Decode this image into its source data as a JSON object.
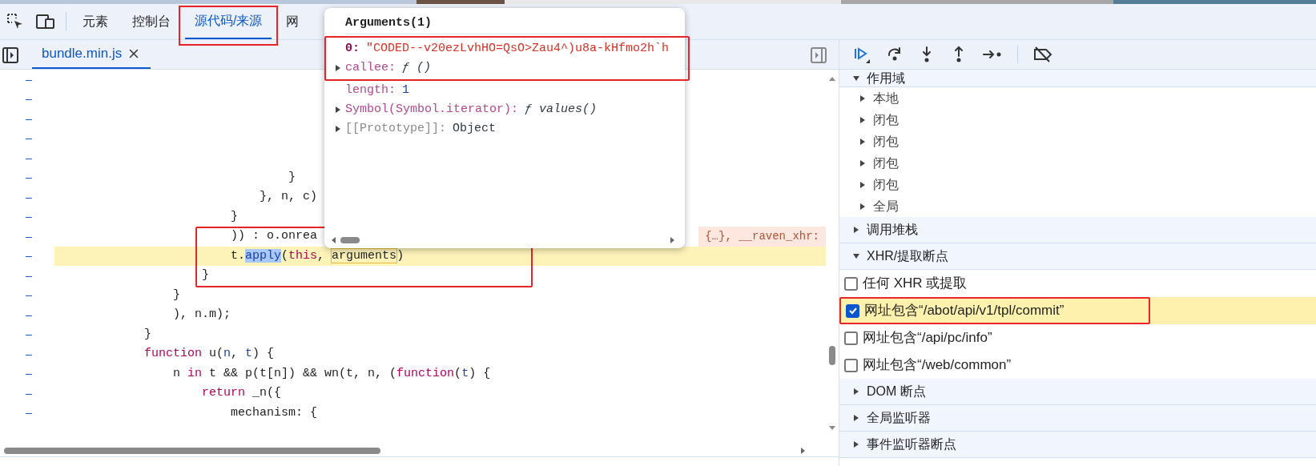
{
  "devtools_tabs": [
    {
      "label": "元素",
      "selected": false,
      "annotated": false
    },
    {
      "label": "控制台",
      "selected": false,
      "annotated": false
    },
    {
      "label": "源代码/来源",
      "selected": true,
      "annotated": true
    },
    {
      "label": "网",
      "selected": false,
      "annotated": false
    }
  ],
  "editor": {
    "file_tab": {
      "label": "bundle.min.js",
      "selected": true
    },
    "lines": [
      {
        "gutter": "–",
        "current": false
      },
      {
        "gutter": "–",
        "current": false
      },
      {
        "gutter": "–",
        "current": false
      },
      {
        "gutter": "–",
        "current": false
      },
      {
        "gutter": "–",
        "current": false
      },
      {
        "gutter": "–",
        "current": false,
        "tokens": [
          {
            "text": "                                }",
            "kind": "plain"
          }
        ]
      },
      {
        "gutter": "–",
        "current": false,
        "tokens": [
          {
            "text": "                            }, n, c)",
            "kind": "plain"
          }
        ]
      },
      {
        "gutter": "–",
        "current": false,
        "tokens": [
          {
            "text": "                        }",
            "kind": "plain"
          }
        ]
      },
      {
        "gutter": "–",
        "current": false,
        "tokens": [
          {
            "text": "                        )) : o.onrea",
            "kind": "plain"
          }
        ],
        "inline_value": "{…}, __raven_xhr:"
      },
      {
        "gutter": "–",
        "current": true,
        "tokens": [
          {
            "text": "                        t.",
            "kind": "plain"
          },
          {
            "text": "apply",
            "kind": "selected"
          },
          {
            "text": "(",
            "kind": "plain"
          },
          {
            "text": "this",
            "kind": "keyword"
          },
          {
            "text": ", ",
            "kind": "plain"
          },
          {
            "text": "arguments",
            "kind": "boxed"
          },
          {
            "text": ")",
            "kind": "plain"
          }
        ]
      },
      {
        "gutter": "–",
        "current": false,
        "tokens": [
          {
            "text": "                    }",
            "kind": "plain"
          }
        ]
      },
      {
        "gutter": "–",
        "current": false,
        "tokens": [
          {
            "text": "                }",
            "kind": "plain"
          }
        ]
      },
      {
        "gutter": "–",
        "current": false,
        "tokens": [
          {
            "text": "                ), n.m);",
            "kind": "plain"
          }
        ]
      },
      {
        "gutter": "–",
        "current": false,
        "tokens": [
          {
            "text": "            }",
            "kind": "plain"
          }
        ]
      },
      {
        "gutter": "–",
        "current": false,
        "tokens": [
          {
            "text": "            function",
            "kind": "keyword"
          },
          {
            "text": " u(",
            "kind": "plain"
          },
          {
            "text": "n",
            "kind": "param"
          },
          {
            "text": ", ",
            "kind": "plain"
          },
          {
            "text": "t",
            "kind": "param"
          },
          {
            "text": ") {",
            "kind": "plain"
          }
        ]
      },
      {
        "gutter": "–",
        "current": false,
        "tokens": [
          {
            "text": "                n ",
            "kind": "plain"
          },
          {
            "text": "in",
            "kind": "keyword"
          },
          {
            "text": " t && p(t[n]) && wn(t, n, (",
            "kind": "plain"
          },
          {
            "text": "function",
            "kind": "keyword"
          },
          {
            "text": "(",
            "kind": "plain"
          },
          {
            "text": "t",
            "kind": "param"
          },
          {
            "text": ") {",
            "kind": "plain"
          }
        ]
      },
      {
        "gutter": "–",
        "current": false,
        "tokens": [
          {
            "text": "                    return",
            "kind": "keyword"
          },
          {
            "text": " _n({",
            "kind": "plain"
          }
        ]
      },
      {
        "gutter": "–",
        "current": false,
        "tokens": [
          {
            "text": "                        mechanism: {",
            "kind": "plain"
          }
        ]
      }
    ]
  },
  "tooltip": {
    "title": "Arguments(1)",
    "properties": [
      {
        "expandable": false,
        "annotated": true,
        "tokens": [
          {
            "text": "0:",
            "kind": "index"
          },
          {
            "text": "\"CODED--v20ezLvhHO=QsO>Zau4^)u8a-kHfmo2h`h",
            "kind": "string"
          }
        ]
      },
      {
        "expandable": true,
        "annotated": true,
        "tokens": [
          {
            "text": "callee:",
            "kind": "property"
          },
          {
            "text": "ƒ ()",
            "kind": "function"
          }
        ]
      },
      {
        "expandable": false,
        "annotated": false,
        "tokens": [
          {
            "text": "length:",
            "kind": "property"
          },
          {
            "text": "1",
            "kind": "number"
          }
        ]
      },
      {
        "expandable": true,
        "annotated": false,
        "tokens": [
          {
            "text": "Symbol(Symbol.iterator):",
            "kind": "property"
          },
          {
            "text": "ƒ values()",
            "kind": "function"
          }
        ]
      },
      {
        "expandable": true,
        "annotated": false,
        "tokens": [
          {
            "text": "[[Prototype]]:",
            "kind": "internal"
          },
          {
            "text": "Object",
            "kind": "object"
          }
        ]
      }
    ]
  },
  "sidebar": {
    "sections": [
      {
        "title": "作用域",
        "expanded": true,
        "kind": "tree",
        "items": [
          {
            "label": "本地",
            "expanded": false
          },
          {
            "label": "闭包",
            "expanded": false
          },
          {
            "label": "闭包",
            "expanded": false
          },
          {
            "label": "闭包",
            "expanded": false
          },
          {
            "label": "闭包",
            "expanded": false
          },
          {
            "label": "全局",
            "expanded": false
          }
        ]
      },
      {
        "title": "调用堆栈",
        "expanded": false
      },
      {
        "title": "XHR/提取断点",
        "expanded": true,
        "kind": "checklist",
        "items": [
          {
            "label": "任何 XHR 或提取",
            "checked": false,
            "highlighted": false,
            "annotated": false
          },
          {
            "label": "网址包含“/abot/api/v1/tpl/commit”",
            "checked": true,
            "highlighted": true,
            "annotated": true
          },
          {
            "label": "网址包含“/api/pc/info”",
            "checked": false,
            "highlighted": false,
            "annotated": false
          },
          {
            "label": "网址包含“/web/common”",
            "checked": false,
            "highlighted": false,
            "annotated": false
          }
        ]
      },
      {
        "title": "DOM 断点",
        "expanded": false
      },
      {
        "title": "全局监听器",
        "expanded": false
      },
      {
        "title": "事件监听器断点",
        "expanded": false
      }
    ]
  }
}
